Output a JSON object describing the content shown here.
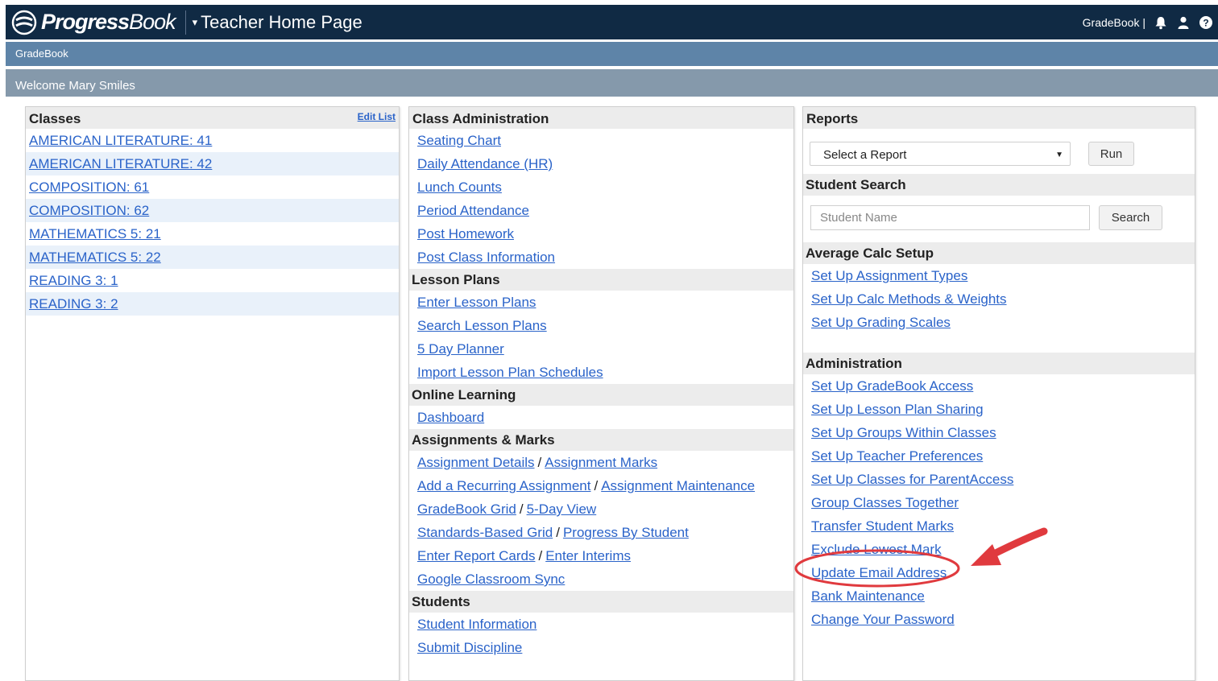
{
  "app": {
    "logo_text_bold": "Progress",
    "logo_text_light": "Book",
    "page_title": "Teacher Home Page",
    "top_right_label": "GradeBook |",
    "subnav_label": "GradeBook",
    "welcome_text": "Welcome Mary Smiles"
  },
  "classes": {
    "title": "Classes",
    "edit_label": "Edit List",
    "items": [
      "AMERICAN LITERATURE: 41",
      "AMERICAN LITERATURE: 42",
      "COMPOSITION: 61",
      "COMPOSITION: 62",
      "MATHEMATICS 5: 21",
      "MATHEMATICS 5: 22",
      "READING 3: 1",
      "READING 3: 2"
    ]
  },
  "class_admin": {
    "title": "Class Administration",
    "links": [
      "Seating Chart",
      "Daily Attendance (HR)",
      "Lunch Counts",
      "Period Attendance",
      "Post Homework",
      "Post Class Information"
    ],
    "lesson_plans_title": "Lesson Plans",
    "lesson_links": [
      "Enter Lesson Plans",
      "Search Lesson Plans",
      "5 Day Planner",
      "Import Lesson Plan Schedules"
    ],
    "online_title": "Online Learning",
    "online_links": [
      "Dashboard"
    ],
    "assignments_title": "Assignments & Marks",
    "assignment_rows": [
      [
        "Assignment Details",
        "Assignment Marks"
      ],
      [
        "Add a Recurring Assignment",
        "Assignment Maintenance"
      ],
      [
        "GradeBook Grid",
        "5-Day View"
      ],
      [
        "Standards-Based Grid",
        "Progress By Student"
      ],
      [
        "Enter Report Cards",
        "Enter Interims"
      ],
      [
        "Google Classroom Sync"
      ]
    ],
    "slash": "/",
    "students_title": "Students",
    "student_links": [
      "Student Information",
      "Submit Discipline"
    ]
  },
  "reports": {
    "title": "Reports",
    "select_value": "Select a Report",
    "run_label": "Run",
    "student_search_title": "Student Search",
    "student_placeholder": "Student Name",
    "search_label": "Search",
    "avg_calc_title": "Average Calc Setup",
    "avg_calc_links": [
      "Set Up Assignment Types",
      "Set Up Calc Methods & Weights",
      "Set Up Grading Scales"
    ],
    "administration_title": "Administration",
    "admin_links": [
      "Set Up GradeBook Access",
      "Set Up Lesson Plan Sharing",
      "Set Up Groups Within Classes",
      "Set Up Teacher Preferences",
      "Set Up Classes for ParentAccess",
      "Group Classes Together",
      "Transfer Student Marks",
      "Exclude Lowest Mark",
      "Update Email Address",
      "Bank Maintenance",
      "Change Your Password"
    ]
  },
  "colors": {
    "topbar": "#102a44",
    "subnav": "#5e84a8",
    "welcome_bar": "#8599ab",
    "link": "#2a63c9",
    "annotation": "#e03a3e"
  },
  "icons": [
    "progressbook-logo-icon",
    "bell-icon",
    "user-icon",
    "help-icon"
  ]
}
